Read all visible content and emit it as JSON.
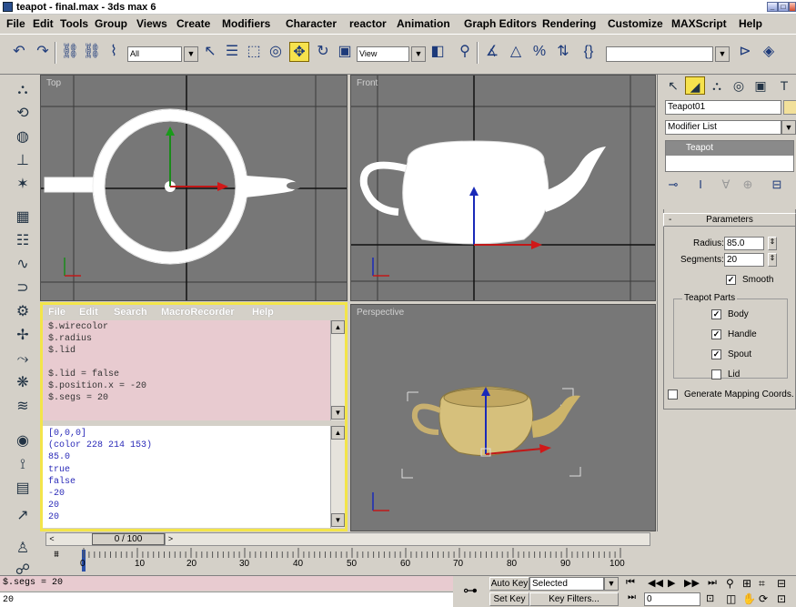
{
  "window": {
    "title": "teapot - final.max - 3ds max 6",
    "icon": "app-icon"
  },
  "menu": [
    "File",
    "Edit",
    "Tools",
    "Group",
    "Views",
    "Create",
    "Modifiers",
    "Character",
    "reactor",
    "Animation",
    "Graph Editors",
    "Rendering",
    "Customize",
    "MAXScript",
    "Help"
  ],
  "toolbar": {
    "selection_filter": "All",
    "reference_coord": "View",
    "named_selection": ""
  },
  "viewports": {
    "top": "Top",
    "front": "Front",
    "perspective": "Perspective"
  },
  "listener": {
    "menu": [
      "File",
      "Edit",
      "Search",
      "MacroRecorder",
      "Help"
    ],
    "macro_lines": "$.wirecolor\n$.radius\n$.lid\n\n$.lid = false\n$.position.x = -20\n$.segs = 20",
    "output_lines": "[0,0,0]\n(color 228 214 153)\n85.0\ntrue\nfalse\n-20\n20\n20"
  },
  "command_panel": {
    "object_name": "Teapot01",
    "object_color": "#f2e09a",
    "modifier_list": "Modifier List",
    "stack_item": "Teapot",
    "rollout_title": "Parameters",
    "radius_label": "Radius:",
    "radius_value": "85.0",
    "segments_label": "Segments:",
    "segments_value": "20",
    "smooth_label": "Smooth",
    "smooth_checked": true,
    "parts_label": "Teapot Parts",
    "parts": [
      {
        "label": "Body",
        "checked": true
      },
      {
        "label": "Handle",
        "checked": true
      },
      {
        "label": "Spout",
        "checked": true
      },
      {
        "label": "Lid",
        "checked": false
      }
    ],
    "mapping_label": "Generate Mapping Coords.",
    "mapping_checked": false
  },
  "timeline": {
    "frame_display": "0 / 100",
    "current_frame": 0,
    "total_frames": 100,
    "ticks": [
      "0",
      "10",
      "20",
      "30",
      "40",
      "50",
      "60",
      "70",
      "80",
      "90",
      "100"
    ]
  },
  "status": {
    "command_line": "$.segs = 20",
    "command_result": "20",
    "auto_key": "Auto Key",
    "set_key": "Set Key",
    "key_mode": "Selected",
    "key_filters": "Key Filters...",
    "frame_field": "0"
  }
}
